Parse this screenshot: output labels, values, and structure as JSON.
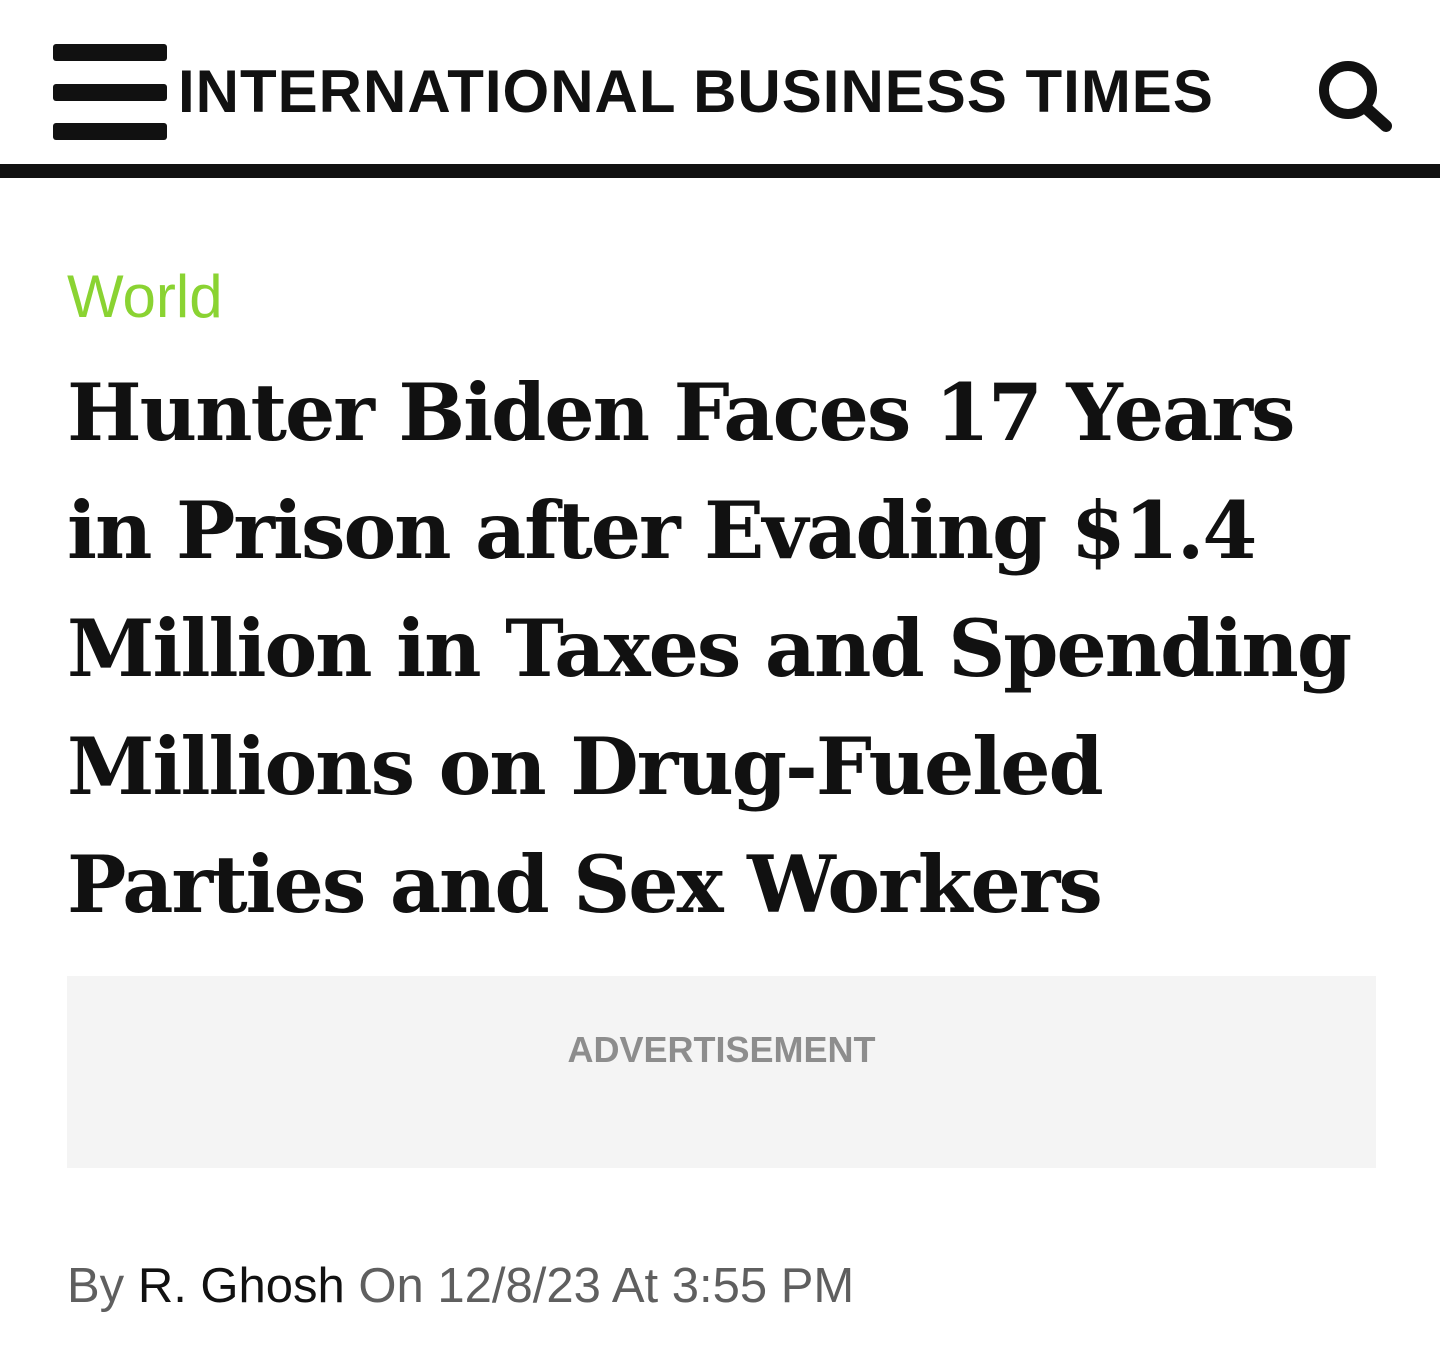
{
  "header": {
    "menu_icon": "hamburger-menu-icon",
    "brand": "INTERNATIONAL BUSINESS TIMES",
    "search_icon": "search-icon"
  },
  "article": {
    "category": "World",
    "headline": "Hunter Biden Faces 17 Years in Prison after Evading $1.4 Million in Taxes and Spending Millions on Drug-Fueled Parties and Sex Workers",
    "advertisement_label": "ADVERTISEMENT",
    "byline": {
      "prefix": "By",
      "author": "R. Ghosh",
      "date_prefix": "On",
      "date": "12/8/23",
      "time_prefix": "At",
      "time": "3:55 PM"
    }
  },
  "colors": {
    "category": "#8ad332",
    "text": "#111111",
    "meta": "#5f5f5f",
    "ad_background": "#f4f4f4",
    "ad_label": "#8d8d8d"
  }
}
